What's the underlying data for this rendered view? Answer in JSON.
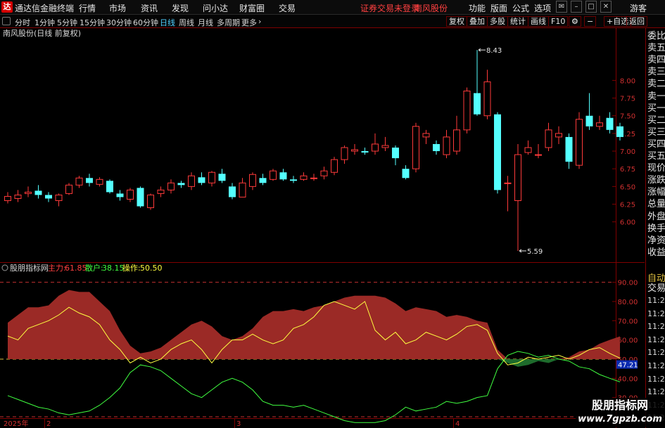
{
  "menubar": {
    "logo": "达",
    "app_title": "通达信金融终端",
    "menu": [
      "行情",
      "市场",
      "资讯",
      "发现",
      "问小达",
      "财富圈",
      "交易"
    ],
    "notice": "证券交易未登录",
    "stock_name": "南风股份",
    "right": [
      "功能",
      "版面",
      "公式",
      "选项"
    ],
    "user": "游客"
  },
  "toolbar": {
    "periods": [
      "分时",
      "1分钟",
      "5分钟",
      "15分钟",
      "30分钟",
      "60分钟",
      "日线",
      "周线",
      "月线",
      "多周期",
      "更多"
    ],
    "active_period": "日线",
    "buttons": [
      "复权",
      "叠加",
      "多股",
      "统计",
      "画线",
      "F10",
      "+自选",
      "返回"
    ]
  },
  "main_chart": {
    "title": "南风股份(日线 前复权)",
    "high_label": "8.43",
    "low_label": "5.59"
  },
  "indicator": {
    "name": "股朋指标网",
    "zhuli_label": "主力:",
    "zhuli_value": "61.85",
    "sanhu_label": "散户:",
    "sanhu_value": "38.15",
    "caozuo_label": "操作:",
    "caozuo_value": "50.50",
    "current_marker": "47.21"
  },
  "xaxis": {
    "labels": [
      "2025年",
      "2",
      "3",
      "4"
    ]
  },
  "sidepanel": {
    "items": [
      "委比",
      "卖五",
      "卖四",
      "卖三",
      "卖二",
      "卖一",
      "买一",
      "买二",
      "买三",
      "买四",
      "买五",
      "现价",
      "涨跌",
      "涨幅",
      "总量",
      "外盘",
      "换手",
      "净资",
      "收益"
    ],
    "auto": "自动",
    "trade": "交易",
    "times": [
      "11:29",
      "11:29",
      "11:29",
      "11:29",
      "11:29",
      "11:29",
      "11:29",
      "11:29",
      "11:29",
      "11:29"
    ]
  },
  "watermark": {
    "line1": "股朋指标网",
    "line2": "www.7gpzb.com"
  },
  "colors": {
    "up": "#ff3a3a",
    "down": "#54ffff",
    "bg": "#000000",
    "axis": "#800000",
    "zhuli": "#ff4040",
    "sanhu": "#40ff40",
    "caozuo": "#ffff40",
    "fill_main": "#9b2a26",
    "fill_low": "#1e6b2c",
    "active_period": "#4fd0ff"
  },
  "chart_data": {
    "type": "candlestick",
    "title": "南风股份(日线 前复权)",
    "ylim": [
      5.5,
      8.6
    ],
    "yticks": [
      6.0,
      6.25,
      6.5,
      6.75,
      7.0,
      7.25,
      7.5,
      7.75,
      8.0
    ],
    "candles": [
      [
        6.3,
        6.36,
        6.42,
        6.26
      ],
      [
        6.33,
        6.38,
        6.45,
        6.28
      ],
      [
        6.4,
        6.42,
        6.5,
        6.35
      ],
      [
        6.44,
        6.38,
        6.52,
        6.33
      ],
      [
        6.38,
        6.33,
        6.42,
        6.28
      ],
      [
        6.3,
        6.38,
        6.4,
        6.22
      ],
      [
        6.4,
        6.52,
        6.55,
        6.38
      ],
      [
        6.52,
        6.62,
        6.65,
        6.48
      ],
      [
        6.62,
        6.55,
        6.68,
        6.5
      ],
      [
        6.53,
        6.6,
        6.63,
        6.5
      ],
      [
        6.58,
        6.42,
        6.6,
        6.4
      ],
      [
        6.4,
        6.35,
        6.45,
        6.3
      ],
      [
        6.32,
        6.45,
        6.48,
        6.28
      ],
      [
        6.48,
        6.22,
        6.5,
        6.2
      ],
      [
        6.2,
        6.38,
        6.4,
        6.17
      ],
      [
        6.4,
        6.45,
        6.5,
        6.35
      ],
      [
        6.45,
        6.55,
        6.6,
        6.4
      ],
      [
        6.55,
        6.52,
        6.58,
        6.48
      ],
      [
        6.5,
        6.65,
        6.7,
        6.45
      ],
      [
        6.63,
        6.55,
        6.7,
        6.52
      ],
      [
        6.55,
        6.7,
        6.72,
        6.5
      ],
      [
        6.68,
        6.58,
        6.75,
        6.55
      ],
      [
        6.5,
        6.35,
        6.55,
        6.32
      ],
      [
        6.35,
        6.55,
        6.62,
        6.35
      ],
      [
        6.5,
        6.67,
        6.7,
        6.45
      ],
      [
        6.62,
        6.55,
        6.68,
        6.52
      ],
      [
        6.6,
        6.72,
        6.75,
        6.58
      ],
      [
        6.7,
        6.6,
        6.75,
        6.58
      ],
      [
        6.6,
        6.58,
        6.65,
        6.55
      ],
      [
        6.6,
        6.65,
        6.7,
        6.58
      ],
      [
        6.62,
        6.62,
        6.68,
        6.58
      ],
      [
        6.65,
        6.72,
        6.78,
        6.6
      ],
      [
        6.7,
        6.88,
        6.92,
        6.66
      ],
      [
        6.88,
        7.05,
        7.08,
        6.82
      ],
      [
        7.0,
        7.02,
        7.1,
        6.95
      ],
      [
        7.0,
        6.98,
        7.05,
        6.95
      ],
      [
        7.0,
        7.1,
        7.25,
        6.95
      ],
      [
        7.05,
        7.08,
        7.2,
        7.0
      ],
      [
        7.05,
        6.9,
        7.08,
        6.8
      ],
      [
        6.75,
        6.62,
        6.8,
        6.6
      ],
      [
        6.75,
        7.35,
        7.4,
        6.7
      ],
      [
        7.2,
        7.25,
        7.3,
        7.1
      ],
      [
        7.1,
        7.0,
        7.15,
        6.95
      ],
      [
        6.95,
        7.2,
        7.3,
        6.9
      ],
      [
        7.0,
        7.3,
        7.5,
        6.95
      ],
      [
        7.3,
        7.85,
        7.9,
        7.25
      ],
      [
        7.82,
        7.52,
        8.43,
        7.5
      ],
      [
        7.5,
        7.98,
        8.15,
        7.45
      ],
      [
        7.52,
        6.45,
        7.55,
        6.4
      ],
      [
        6.55,
        6.55,
        6.65,
        6.15
      ],
      [
        6.3,
        6.95,
        7.1,
        5.59
      ],
      [
        6.98,
        7.05,
        7.15,
        6.95
      ],
      [
        6.95,
        6.95,
        7.1,
        6.9
      ],
      [
        7.05,
        7.3,
        7.4,
        7.0
      ],
      [
        7.2,
        7.25,
        7.35,
        7.1
      ],
      [
        7.2,
        6.85,
        7.25,
        6.75
      ],
      [
        6.8,
        7.45,
        7.55,
        6.75
      ],
      [
        7.5,
        7.35,
        7.82,
        7.3
      ],
      [
        7.35,
        7.4,
        7.5,
        7.3
      ],
      [
        7.47,
        7.3,
        7.55,
        7.25
      ],
      [
        7.35,
        7.2,
        7.4,
        7.15
      ]
    ],
    "candle_order": [
      "open",
      "close",
      "high",
      "low"
    ],
    "indicator": {
      "ylim": [
        20,
        95
      ],
      "yticks": [
        30,
        40,
        50,
        60,
        70,
        80,
        90
      ],
      "dashed_levels": [
        90,
        50,
        20
      ],
      "zhuli": [
        69,
        73,
        77,
        77,
        78,
        83,
        86,
        85,
        85,
        80,
        75,
        65,
        57,
        53,
        54,
        56,
        60,
        64,
        68,
        70,
        67,
        62,
        60,
        62,
        66,
        72,
        75,
        75,
        76,
        75,
        77,
        78,
        80,
        82,
        83,
        83,
        83,
        82,
        79,
        75,
        77,
        76,
        75,
        72,
        73,
        72,
        70,
        69,
        55,
        48,
        46,
        47,
        49,
        48,
        50,
        51,
        54,
        55,
        58,
        60,
        61.85
      ],
      "sanhu": [
        31,
        29,
        27,
        25,
        24,
        22,
        21,
        22,
        23,
        26,
        30,
        35,
        43,
        47,
        46,
        44,
        40,
        36,
        32,
        30,
        34,
        38,
        40,
        38,
        34,
        28,
        26,
        26,
        25,
        26,
        24,
        22,
        20,
        18,
        17,
        17,
        17,
        18,
        21,
        25,
        23,
        24,
        25,
        28,
        27,
        28,
        30,
        31,
        45,
        52,
        54,
        53,
        51,
        52,
        50,
        49,
        46,
        45,
        42,
        40,
        38.15
      ],
      "caozuo": [
        62,
        60,
        66,
        68,
        70,
        73,
        77,
        74,
        72,
        68,
        60,
        55,
        48,
        51,
        48,
        50,
        55,
        58,
        60,
        55,
        48,
        55,
        60,
        60,
        63,
        60,
        58,
        60,
        66,
        68,
        72,
        78,
        80,
        78,
        76,
        80,
        65,
        60,
        64,
        58,
        60,
        64,
        62,
        60,
        63,
        67,
        68,
        65,
        53,
        47,
        48,
        51,
        50,
        51,
        52,
        50,
        52,
        55,
        56,
        53,
        50.5
      ]
    }
  }
}
